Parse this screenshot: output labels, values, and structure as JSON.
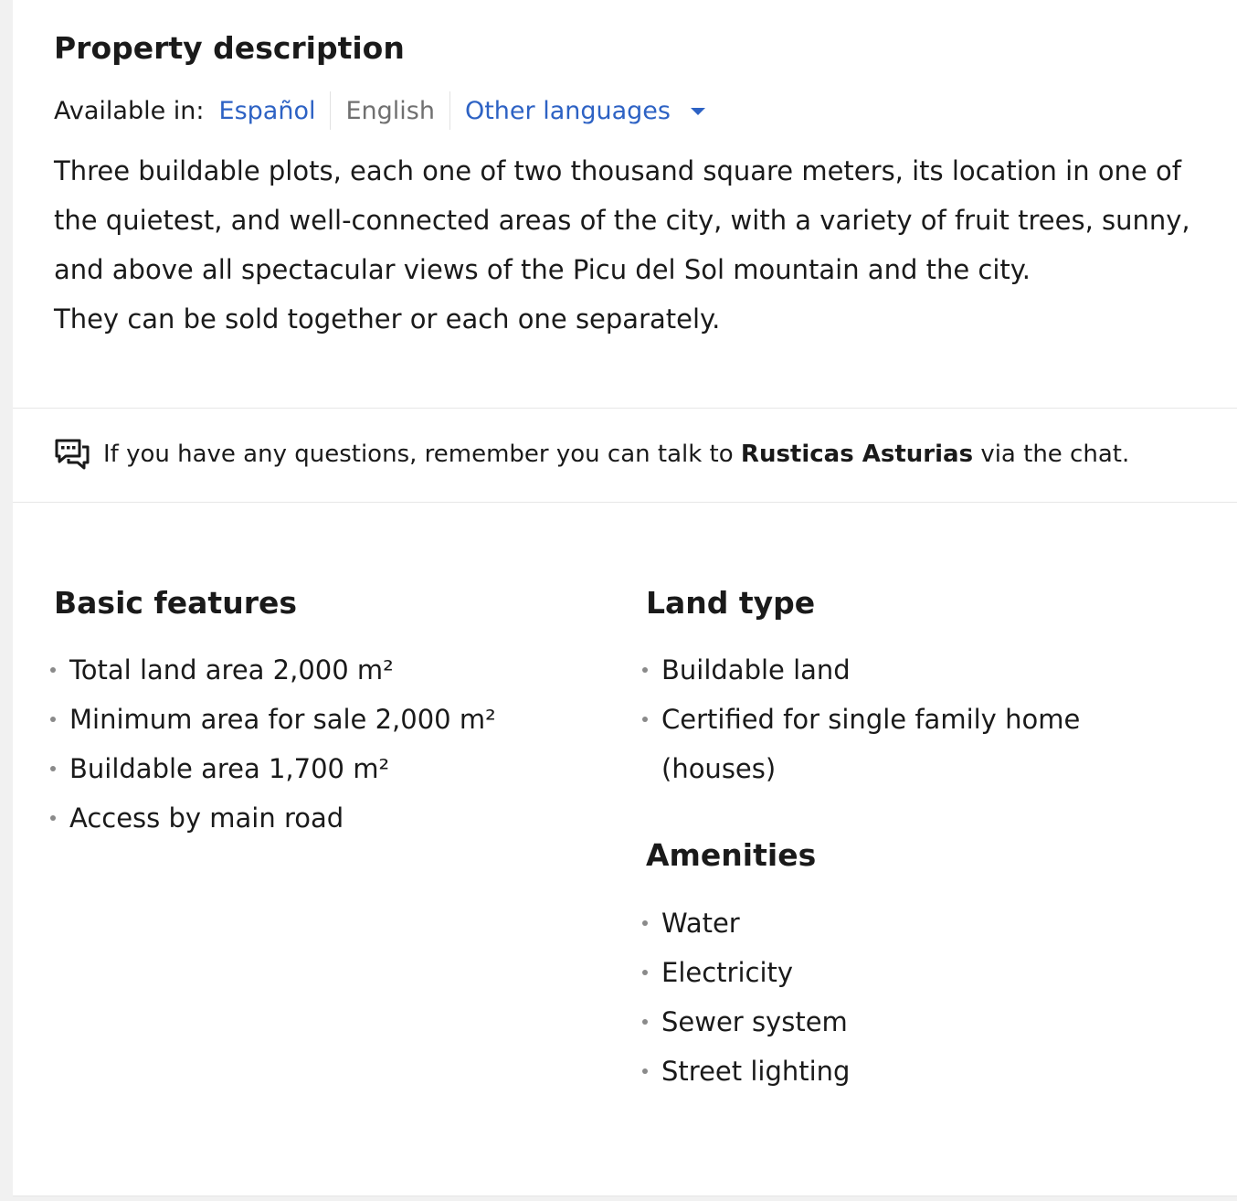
{
  "description": {
    "title": "Property description",
    "available_label": "Available in:",
    "languages": [
      "Español",
      "English"
    ],
    "other_languages_label": "Other languages",
    "paragraphs": [
      "Three buildable plots, each one of two thousand square meters, its location in one of the quietest, and well-connected areas of the city, with a variety of fruit trees, sunny, and above all spectacular views of the Picu del Sol mountain and the city.",
      "They can be sold together or each one separately."
    ]
  },
  "chat_note": {
    "icon": "chat-bubbles-icon",
    "prefix": "If you have any questions, remember you can talk to",
    "advertiser": "Rusticas Asturias",
    "suffix": "via the chat."
  },
  "basic_features": {
    "title": "Basic features",
    "items": [
      "Total land area 2,000 m²",
      "Minimum area for sale 2,000 m²",
      "Buildable area 1,700 m²",
      "Access by main road"
    ]
  },
  "land_type": {
    "title": "Land type",
    "items": [
      "Buildable land",
      "Certified for single family home (houses)"
    ]
  },
  "amenities": {
    "title": "Amenities",
    "items": [
      "Water",
      "Electricity",
      "Sewer system",
      "Street lighting"
    ]
  },
  "colors": {
    "link": "#2d62c4",
    "muted_text": "#707070",
    "text": "#1a1a1a",
    "page_background": "#f1f1f1"
  }
}
